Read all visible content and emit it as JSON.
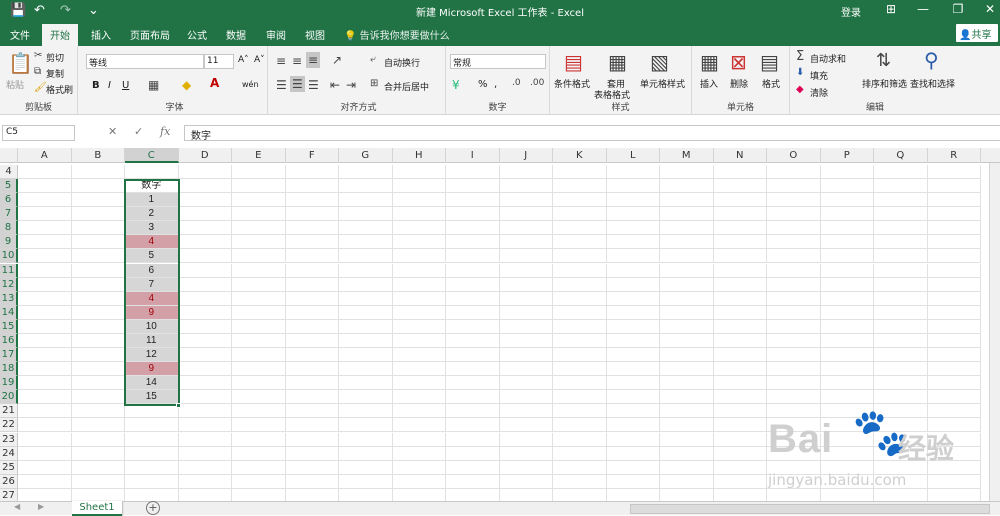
{
  "titlebar": {
    "save_icon": "💾",
    "undo_icon": "↶",
    "redo_icon": "↷",
    "custom_icon": "⌄",
    "title": "新建 Microsoft Excel 工作表 - Excel",
    "login": "登录",
    "ribbon_display_icon": "⊞",
    "minimize_icon": "—",
    "restore_icon": "❐",
    "close_icon": "✕"
  },
  "tabs": [
    "文件",
    "开始",
    "插入",
    "页面布局",
    "公式",
    "数据",
    "审阅",
    "视图"
  ],
  "tell_me": "告诉我你想要做什么",
  "share": "共享",
  "ribbon": {
    "clipboard": {
      "paste": "粘贴",
      "cut": "剪切",
      "copy": "复制",
      "format_painter": "格式刷",
      "label": "剪贴板"
    },
    "font": {
      "font_name": "等线",
      "font_size": "11",
      "bold": "B",
      "italic": "I",
      "underline": "U",
      "grow": "A˄",
      "shrink": "A˅",
      "wen": "wén",
      "label": "字体"
    },
    "alignment": {
      "wrap": "自动换行",
      "merge": "合并后居中",
      "label": "对齐方式"
    },
    "number": {
      "format": "常规",
      "percent": "%",
      "comma": ",",
      "label": "数字"
    },
    "styles": {
      "conditional": "条件格式",
      "table_l1": "套用",
      "table_l2": "表格格式",
      "cell_styles": "单元格样式",
      "label": "样式"
    },
    "cells": {
      "insert": "插入",
      "delete": "删除",
      "format": "格式",
      "label": "单元格"
    },
    "editing": {
      "autosum": "自动求和",
      "fill": "填充",
      "clear": "清除",
      "sort": "排序和筛选",
      "find": "查找和选择",
      "label": "编辑"
    }
  },
  "formula_bar": {
    "name_box": "C5",
    "cancel": "✕",
    "enter": "✓",
    "fx": "fx",
    "value": "数字"
  },
  "columns": [
    "A",
    "B",
    "C",
    "D",
    "E",
    "F",
    "G",
    "H",
    "I",
    "J",
    "K",
    "L",
    "M",
    "N",
    "O",
    "P",
    "Q",
    "R"
  ],
  "active_column": "C",
  "rows": [
    "4",
    "5",
    "6",
    "7",
    "8",
    "9",
    "10",
    "11",
    "12",
    "13",
    "14",
    "15",
    "16",
    "17",
    "18",
    "19",
    "20",
    "21",
    "22",
    "23",
    "24",
    "25",
    "26",
    "27"
  ],
  "column_c": [
    {
      "row": "5",
      "value": "数字",
      "state": "header"
    },
    {
      "row": "6",
      "value": "1",
      "state": "normal"
    },
    {
      "row": "7",
      "value": "2",
      "state": "normal"
    },
    {
      "row": "8",
      "value": "3",
      "state": "normal"
    },
    {
      "row": "9",
      "value": "4",
      "state": "duplicate"
    },
    {
      "row": "10",
      "value": "5",
      "state": "normal"
    },
    {
      "row": "11",
      "value": "6",
      "state": "normal"
    },
    {
      "row": "12",
      "value": "7",
      "state": "normal"
    },
    {
      "row": "13",
      "value": "4",
      "state": "duplicate"
    },
    {
      "row": "14",
      "value": "9",
      "state": "duplicate"
    },
    {
      "row": "15",
      "value": "10",
      "state": "normal"
    },
    {
      "row": "16",
      "value": "11",
      "state": "normal"
    },
    {
      "row": "17",
      "value": "12",
      "state": "normal"
    },
    {
      "row": "18",
      "value": "9",
      "state": "duplicate"
    },
    {
      "row": "19",
      "value": "14",
      "state": "normal"
    },
    {
      "row": "20",
      "value": "15",
      "state": "normal"
    }
  ],
  "colors": {
    "excel_green": "#217346",
    "duplicate_fill": "#d4a0a8",
    "duplicate_text": "#9c0006",
    "selected_fill": "#d6d6d6"
  },
  "sheet_tab": "Sheet1",
  "add_sheet": "+",
  "watermark": {
    "brand": "Bai",
    "paw": "🐾",
    "brand2": "经验",
    "url": "jingyan.baidu.com"
  }
}
